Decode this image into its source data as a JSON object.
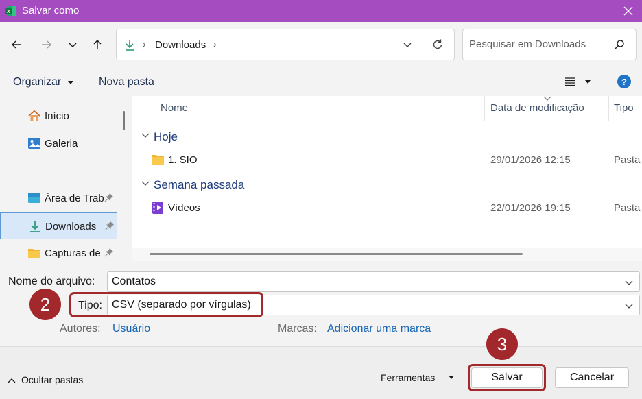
{
  "window": {
    "title": "Salvar como",
    "titlebar_color": "#a54cc0"
  },
  "nav": {
    "breadcrumb": "Downloads",
    "search_placeholder": "Pesquisar em Downloads"
  },
  "toolbar": {
    "organize_label": "Organizar",
    "new_folder_label": "Nova pasta"
  },
  "sidebar": {
    "items": [
      {
        "label": "Início",
        "icon": "home-icon"
      },
      {
        "label": "Galeria",
        "icon": "gallery-icon"
      },
      {
        "label": "Área de Trab",
        "icon": "desktop-icon",
        "pinned": true
      },
      {
        "label": "Downloads",
        "icon": "download-icon",
        "pinned": true,
        "selected": true
      },
      {
        "label": "Capturas de T",
        "icon": "folder-icon",
        "pinned": true
      }
    ]
  },
  "filelist": {
    "columns": [
      "Nome",
      "Data de modificação",
      "Tipo"
    ],
    "groups": [
      {
        "label": "Hoje",
        "rows": [
          {
            "name": "1. SIO",
            "date": "29/01/2026 12:15",
            "type": "Pasta de",
            "icon": "folder-icon"
          }
        ]
      },
      {
        "label": "Semana passada",
        "rows": [
          {
            "name": "Vídeos",
            "date": "22/01/2026 19:15",
            "type": "Pasta de",
            "icon": "videos-folder-icon"
          }
        ]
      }
    ]
  },
  "form": {
    "filename_label": "Nome do arquivo:",
    "filename_value": "Contatos",
    "type_label": "Tipo:",
    "type_value": "CSV (separado por vírgulas)",
    "authors_label": "Autores:",
    "authors_value": "Usuário",
    "tags_label": "Marcas:",
    "tags_value": "Adicionar uma marca"
  },
  "annotations": {
    "step_type": "2",
    "step_save": "3",
    "highlight_color": "#a3282b"
  },
  "footer": {
    "hide_folders_label": "Ocultar pastas",
    "tools_label": "Ferramentas",
    "save_label": "Salvar",
    "cancel_label": "Cancelar"
  }
}
